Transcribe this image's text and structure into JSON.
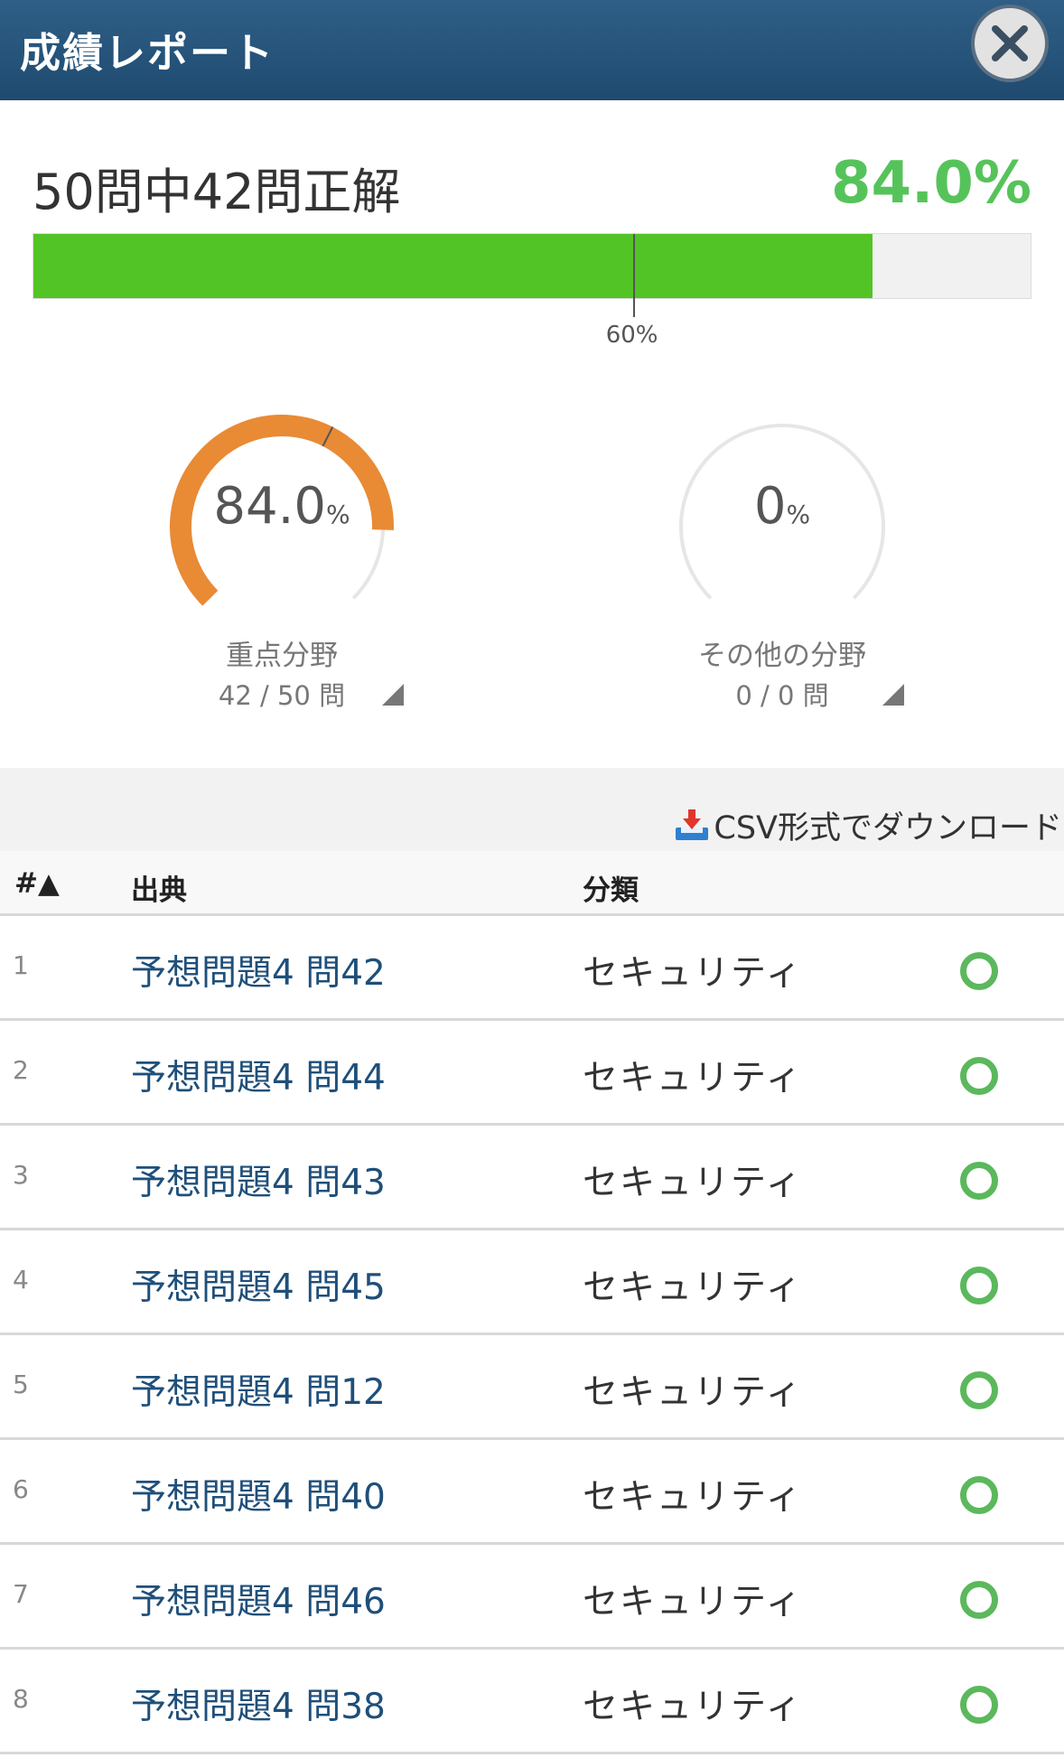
{
  "header": {
    "title": "成績レポート"
  },
  "summary": {
    "text": "50問中42問正解",
    "percent_text": "84.0%",
    "progress": 0.84,
    "pass_line": 0.6,
    "pass_line_label": "60%"
  },
  "gauges": [
    {
      "value_text": "84.0",
      "unit": "%",
      "label": "重点分野",
      "count": "42 / 50 問",
      "fraction": 0.84,
      "color": "#e98a35"
    },
    {
      "value_text": "0",
      "unit": "%",
      "label": "その他の分野",
      "count": "0 / 0 問",
      "fraction": 0,
      "color": "#e98a35"
    }
  ],
  "toolbar": {
    "csv_label": "CSV形式でダウンロード",
    "csv_icon": "download-tray-icon"
  },
  "table": {
    "headers": {
      "num": "#▲",
      "source": "出典",
      "category": "分類"
    },
    "rows": [
      {
        "num": "1",
        "source": "予想問題4 問42",
        "category": "セキュリティ",
        "result": "correct"
      },
      {
        "num": "2",
        "source": "予想問題4 問44",
        "category": "セキュリティ",
        "result": "correct"
      },
      {
        "num": "3",
        "source": "予想問題4 問43",
        "category": "セキュリティ",
        "result": "correct"
      },
      {
        "num": "4",
        "source": "予想問題4 問45",
        "category": "セキュリティ",
        "result": "correct"
      },
      {
        "num": "5",
        "source": "予想問題4 問12",
        "category": "セキュリティ",
        "result": "correct"
      },
      {
        "num": "6",
        "source": "予想問題4 問40",
        "category": "セキュリティ",
        "result": "correct"
      },
      {
        "num": "7",
        "source": "予想問題4 問46",
        "category": "セキュリティ",
        "result": "correct"
      },
      {
        "num": "8",
        "source": "予想問題4 問38",
        "category": "セキュリティ",
        "result": "correct"
      }
    ]
  },
  "colors": {
    "accent_green": "#56c35a",
    "bar_green": "#52c425",
    "header_blue": "#1f4a70",
    "link_blue": "#1f4f7a",
    "correct": "#5bb85c"
  }
}
